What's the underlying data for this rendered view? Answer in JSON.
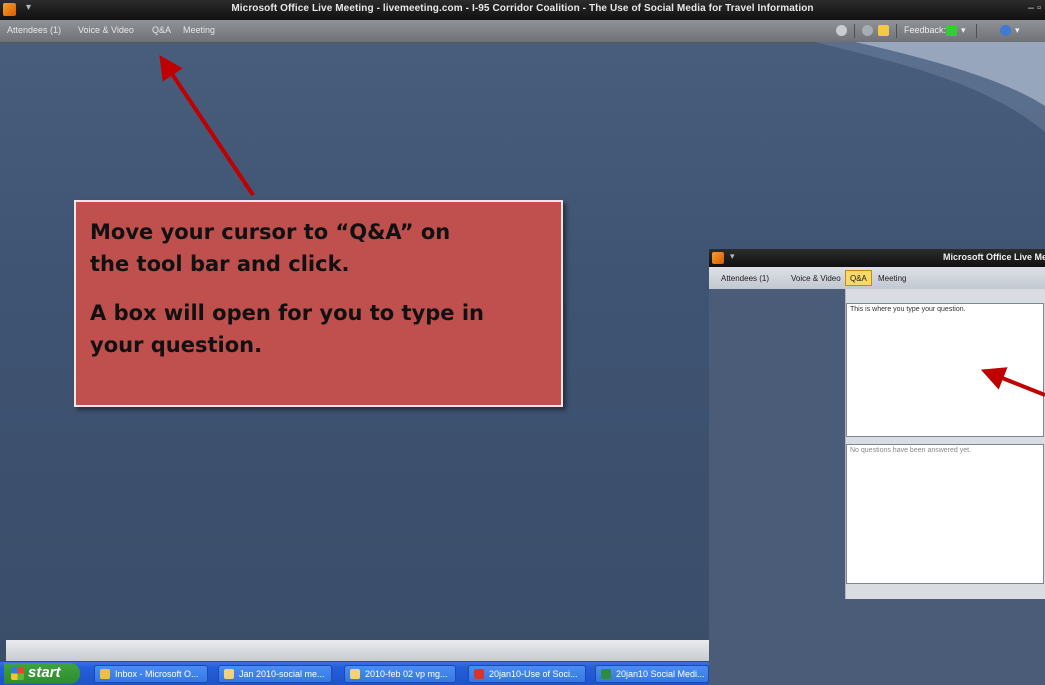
{
  "window": {
    "title": "Microsoft Office Live Meeting - livemeeting.com - I-95 Corridor Coalition - The Use of Social Media for Travel Information",
    "sys_menu": "▾",
    "controls": "– ▫"
  },
  "menubar": {
    "items": [
      {
        "label": "Attendees (1)"
      },
      {
        "label": "Voice & Video"
      },
      {
        "label": "Q&A"
      },
      {
        "label": "Meeting"
      }
    ],
    "feedback_label": "Feedback:"
  },
  "callout": {
    "line1": "Move your cursor to “Q&A” on",
    "line2": "the tool bar and click.",
    "line3": "A box will open for you to type in",
    "line4": "your question."
  },
  "inset": {
    "title": "Microsoft Office Live Me",
    "menubar": [
      {
        "label": "Attendees (1)"
      },
      {
        "label": "Voice & Video"
      },
      {
        "label": "Q&A"
      },
      {
        "label": "Meeting"
      }
    ],
    "question_placeholder": "This is where you type your question.",
    "answers_placeholder": "No questions have been answered yet."
  },
  "taskbar": {
    "start_label": "start",
    "items": [
      {
        "label": "Inbox - Microsoft O...",
        "icon": "outlook-icon"
      },
      {
        "label": "Jan 2010-social me...",
        "icon": "folder-icon"
      },
      {
        "label": "2010-feb 02 vp mg...",
        "icon": "folder-icon"
      },
      {
        "label": "20jan10-Use of Soci...",
        "icon": "pdf-icon"
      },
      {
        "label": "20jan10 Social Medi...",
        "icon": "excel-icon"
      }
    ]
  },
  "colors": {
    "callout": "#c0504d",
    "arrow": "#c00000",
    "desktop": "#42587a"
  }
}
